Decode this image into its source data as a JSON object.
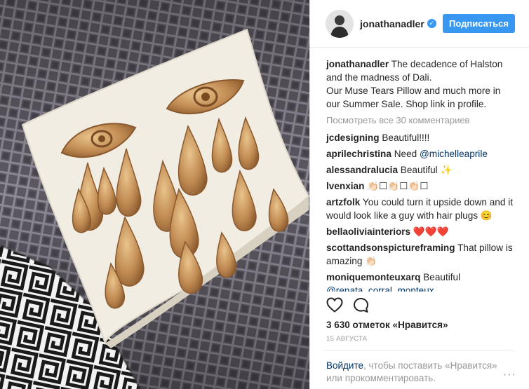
{
  "post": {
    "username": "jonathanadler",
    "verified_icon": "verified-badge-icon",
    "follow_label": "Подписаться",
    "caption_user": "jonathanadler",
    "caption_text": "The decadence of Halston and the madness of Dali.\nOur Muse Tears Pillow and much more in our Summer Sale. Shop link in profile.",
    "view_all": "Посмотреть все 30 комментариев",
    "comments": [
      {
        "user": "jcdesigning",
        "text": "Beautiful!!!!"
      },
      {
        "user": "aprilechristina",
        "text": "Need ",
        "mention": "@michelleaprile"
      },
      {
        "user": "alessandralucia",
        "text": "Beautiful ✨"
      },
      {
        "user": "lvenxian",
        "text": "👏🏻☐👏🏻☐👏🏻☐"
      },
      {
        "user": "artzfolk",
        "text": "You could turn it upside down and it would look like a guy with hair plugs 😊"
      },
      {
        "user": "bellaoliviainteriors",
        "text": "❤️❤️❤️"
      },
      {
        "user": "scottandsonspictureframing",
        "text": "That pillow is amazing 👏🏻"
      },
      {
        "user": "moniquemonteuxarq",
        "text": "Beautiful ",
        "mention": "@renata_corral_monteux"
      }
    ],
    "likes": "3 630 отметок «Нравится»",
    "date": "15 АВГУСТА",
    "login_link": "Войдите",
    "login_text": ", чтобы поставить «Нравится» или прокомментировать.",
    "more": "···"
  },
  "colors": {
    "accent": "#3897f0",
    "link": "#003569",
    "muted": "#999999"
  }
}
